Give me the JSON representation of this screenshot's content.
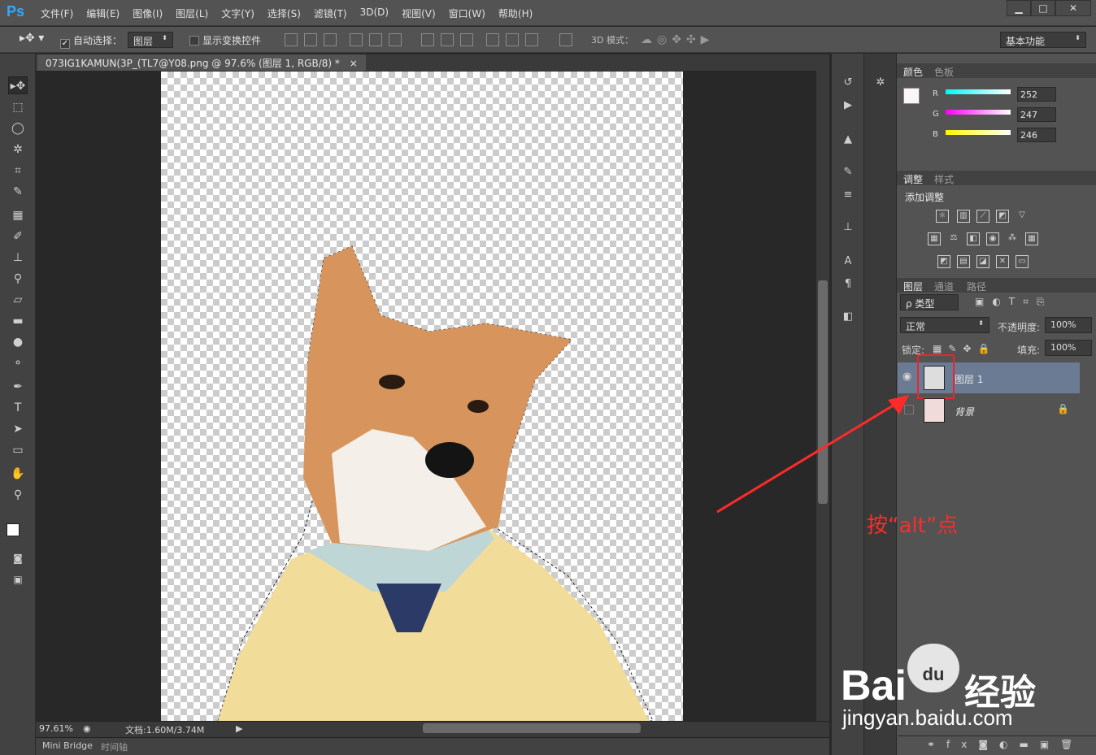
{
  "app": {
    "logo": "Ps"
  },
  "menu": [
    "文件(F)",
    "编辑(E)",
    "图像(I)",
    "图层(L)",
    "文字(Y)",
    "选择(S)",
    "滤镜(T)",
    "3D(D)",
    "视图(V)",
    "窗口(W)",
    "帮助(H)"
  ],
  "window": {
    "min": "▁",
    "max": "□",
    "close": "✕"
  },
  "options": {
    "auto_select_label": "自动选择：",
    "auto_select_value": "图层",
    "show_transform_label": "显示变换控件",
    "mode3d_label": "3D 模式：",
    "workspace": "基本功能"
  },
  "document": {
    "tab_title": "073IG1KAMUN(3P_(TL7@Y08.png @ 97.6% (图层 1, RGB/8) *",
    "close": "×"
  },
  "status": {
    "zoom": "97.61%",
    "doc_info": "文档:1.60M/3.74M"
  },
  "bottom_tabs": [
    "Mini Bridge",
    "时间轴"
  ],
  "color_panel": {
    "tabs": [
      "颜色",
      "色板"
    ],
    "r_label": "R",
    "g_label": "G",
    "b_label": "B",
    "r": "252",
    "g": "247",
    "b": "246"
  },
  "adjust_panel": {
    "tabs": [
      "调整",
      "样式"
    ],
    "add_label": "添加调整"
  },
  "layers_panel": {
    "tabs": [
      "图层",
      "通道",
      "路径"
    ],
    "filter": "ρ 类型",
    "blend": "正常",
    "opacity_label": "不透明度:",
    "opacity": "100%",
    "lock_label": "锁定:",
    "fill_label": "填充:",
    "fill": "100%",
    "layers": [
      {
        "name": "图层 1",
        "visible": true,
        "selected": true
      },
      {
        "name": "背景",
        "visible": false,
        "locked": true
      }
    ]
  },
  "annotation": {
    "text": "按“alt”点"
  },
  "watermark": {
    "brand": "Bai",
    "du": "du",
    "cn": "经验",
    "url": "jingyan.baidu.com"
  },
  "colors": {
    "accent": "#31a8ff",
    "annotation": "#ff2a2a",
    "selected_layer": "#6a7b93"
  }
}
